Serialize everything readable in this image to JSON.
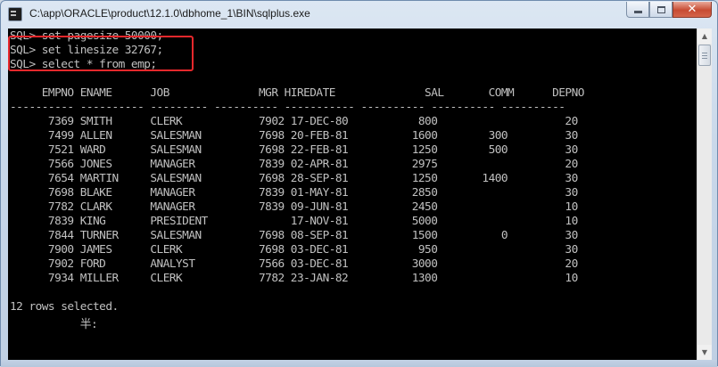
{
  "window": {
    "title": "C:\\app\\ORACLE\\product\\12.1.0\\dbhome_1\\BIN\\sqlplus.exe",
    "icon": "console-app-icon",
    "buttons": {
      "minimize": "minimize-icon",
      "maximize": "maximize-icon",
      "close": "close-icon"
    }
  },
  "console": {
    "lines": [
      "SQL> set pagesize 50000;",
      "SQL> set linesize 32767;",
      "SQL> select * from emp;",
      "",
      "     EMPNO ENAME      JOB              MGR HIREDATE              SAL       COMM      DEPNO",
      "---------- ---------- --------- ---------- ----------- ---------- ---------- ----------",
      "      7369 SMITH      CLERK            7902 17-DEC-80           800                    20",
      "      7499 ALLEN      SALESMAN         7698 20-FEB-81          1600        300         30",
      "      7521 WARD       SALESMAN         7698 22-FEB-81          1250        500         30",
      "      7566 JONES      MANAGER          7839 02-APR-81          2975                    20",
      "      7654 MARTIN     SALESMAN         7698 28-SEP-81          1250       1400         30",
      "      7698 BLAKE      MANAGER          7839 01-MAY-81          2850                    30",
      "      7782 CLARK      MANAGER          7839 09-JUN-81          2450                    10",
      "      7839 KING       PRESIDENT             17-NOV-81          5000                    10",
      "      7844 TURNER     SALESMAN         7698 08-SEP-81          1500          0         30",
      "      7900 JAMES      CLERK            7698 03-DEC-81           950                    30",
      "      7902 FORD       ANALYST          7566 03-DEC-81          3000                    20",
      "      7934 MILLER     CLERK            7782 23-JAN-82          1300                    10",
      "",
      "12 rows selected.",
      "           半:"
    ],
    "colors": {
      "background": "#000000",
      "text": "#c0c0c0",
      "highlight": "#e8282c"
    }
  }
}
